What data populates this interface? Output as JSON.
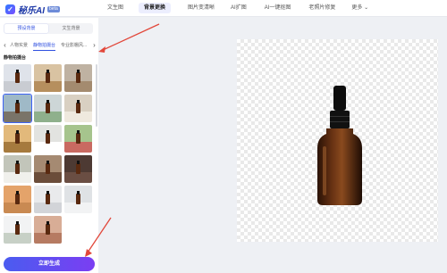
{
  "header": {
    "logo_text": "秘乐AI",
    "logo_badge": "beta",
    "nav": [
      {
        "label": "文生图",
        "active": false
      },
      {
        "label": "背景更换",
        "active": true
      },
      {
        "label": "图片变清晰",
        "active": false
      },
      {
        "label": "AI扩图",
        "active": false
      },
      {
        "label": "AI一键抠图",
        "active": false
      },
      {
        "label": "老照片修复",
        "active": false
      },
      {
        "label": "更多",
        "active": false
      }
    ]
  },
  "sidebar": {
    "segments": [
      {
        "label": "预设背景",
        "active": true
      },
      {
        "label": "文生背景",
        "active": false
      }
    ],
    "tabs": [
      {
        "label": "人物实景",
        "active": false
      },
      {
        "label": "静物拍摄台",
        "active": true
      },
      {
        "label": "专业影棚风...",
        "active": false
      }
    ],
    "section_title": "静物拍摄台",
    "thumbnails": [
      {
        "bg": "#dfe3ea",
        "floor": "#c9ccd2",
        "selected": false
      },
      {
        "bg": "#d9c3a2",
        "floor": "#b68f5e",
        "selected": false
      },
      {
        "bg": "#bfb2a2",
        "floor": "#a48b6f",
        "selected": false
      },
      {
        "bg": "#9fb9c7",
        "floor": "#7a7469",
        "selected": true
      },
      {
        "bg": "#cdd6d7",
        "floor": "#8fb08c",
        "selected": false
      },
      {
        "bg": "#d9d0c2",
        "floor": "#efe9de",
        "selected": false
      },
      {
        "bg": "#e2b97b",
        "floor": "#a67a3e",
        "selected": false
      },
      {
        "bg": "#e2e3e0",
        "floor": "#ffffff",
        "selected": false
      },
      {
        "bg": "#a6c48d",
        "floor": "#c96a61",
        "selected": false
      },
      {
        "bg": "#c2c5ba",
        "floor": "#f0f0ec",
        "selected": false
      },
      {
        "bg": "#a58a72",
        "floor": "#6b4d3a",
        "selected": false
      },
      {
        "bg": "#4d3a33",
        "floor": "#6a4e43",
        "selected": false
      },
      {
        "bg": "#e4a36a",
        "floor": "#c98a52",
        "selected": false
      },
      {
        "bg": "#e9eaec",
        "floor": "#d2d4d8",
        "selected": false
      },
      {
        "bg": "#dfe2e5",
        "floor": "#f2f3f4",
        "selected": false
      },
      {
        "bg": "#f2f3f4",
        "floor": "#c7d0c6",
        "selected": false
      },
      {
        "bg": "#d8ad96",
        "floor": "#b67b62",
        "selected": false
      }
    ],
    "generate_label": "立即生成"
  },
  "colors": {
    "accent": "#3050e0",
    "arrow": "#e2473a"
  },
  "icons": {
    "tab_prev": "chevron-left-icon",
    "tab_next": "chevron-right-icon",
    "more_dropdown": "chevron-down-icon"
  }
}
